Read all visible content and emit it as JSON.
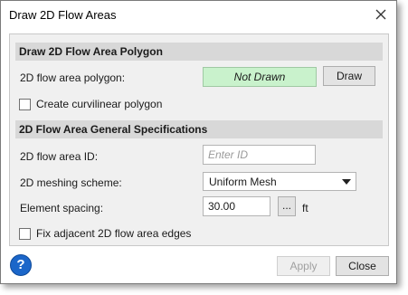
{
  "window": {
    "title": "Draw 2D Flow Areas"
  },
  "polygon_section": {
    "header": "Draw 2D Flow Area Polygon",
    "polygon_label": "2D flow area polygon:",
    "polygon_status": "Not Drawn",
    "draw_button": "Draw",
    "curvilinear_label": "Create curvilinear polygon",
    "curvilinear_checked": false
  },
  "specs_section": {
    "header": "2D Flow Area General Specifications",
    "id_label": "2D flow area ID:",
    "id_value": "",
    "id_placeholder": "Enter ID",
    "mesh_label": "2D meshing scheme:",
    "mesh_value": "Uniform Mesh",
    "spacing_label": "Element spacing:",
    "spacing_value": "30.00",
    "browse_button": "...",
    "spacing_unit": "ft",
    "fix_edges_label": "Fix adjacent 2D flow area edges",
    "fix_edges_checked": false
  },
  "footer": {
    "help_icon": "?",
    "apply_button": "Apply",
    "close_button": "Close"
  },
  "colors": {
    "status_bg": "#c9f2cc",
    "help_blue": "#1b66c9"
  }
}
